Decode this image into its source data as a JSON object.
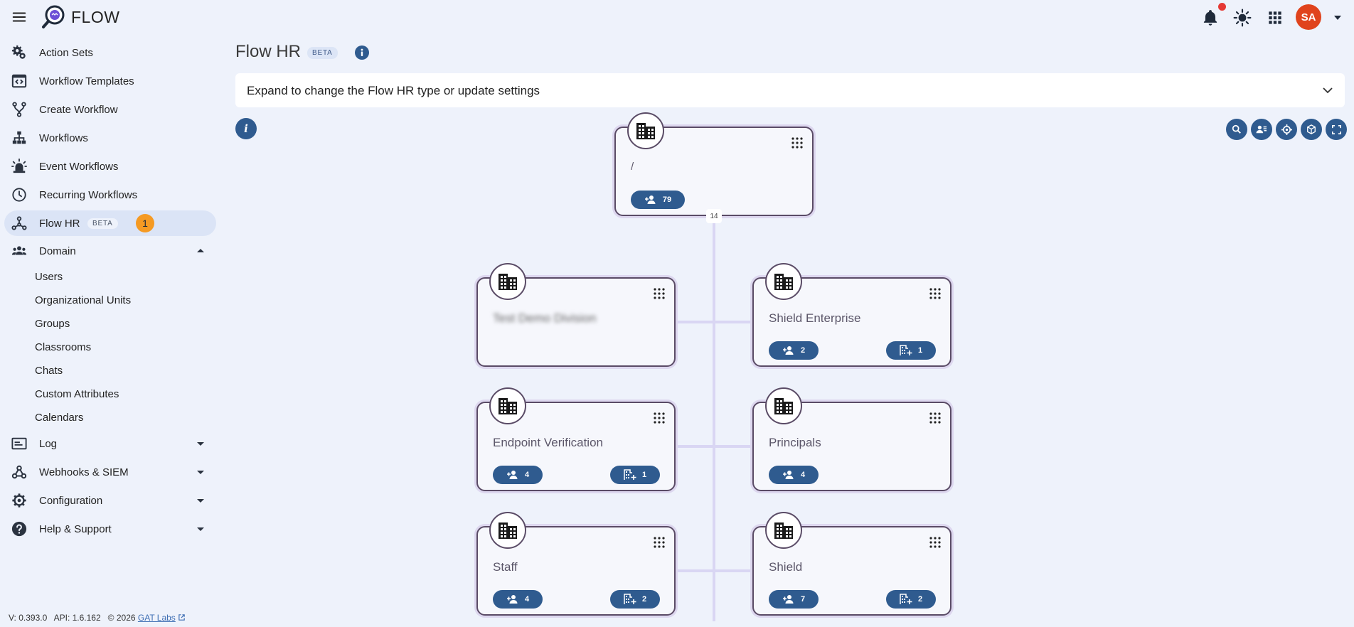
{
  "header": {
    "app_name": "FLOW",
    "avatar_initials": "SA",
    "accent_color": "#2f5b8f",
    "avatar_color": "#e0431c"
  },
  "sidebar": {
    "items": [
      {
        "label": "Action Sets",
        "icon": "gears-icon"
      },
      {
        "label": "Workflow Templates",
        "icon": "template-icon"
      },
      {
        "label": "Create Workflow",
        "icon": "branch-icon"
      },
      {
        "label": "Workflows",
        "icon": "hierarchy-icon"
      },
      {
        "label": "Event Workflows",
        "icon": "alarm-icon"
      },
      {
        "label": "Recurring Workflows",
        "icon": "clock-icon"
      },
      {
        "label": "Flow HR",
        "icon": "org-icon",
        "badge": "BETA",
        "count": "1",
        "active": true
      },
      {
        "label": "Domain",
        "icon": "people-icon",
        "expanded": true
      },
      {
        "label": "Log",
        "icon": "log-icon"
      },
      {
        "label": "Webhooks & SIEM",
        "icon": "webhook-icon"
      },
      {
        "label": "Configuration",
        "icon": "gear-icon"
      },
      {
        "label": "Help & Support",
        "icon": "help-icon"
      }
    ],
    "domain_subitems": [
      "Users",
      "Organizational Units",
      "Groups",
      "Classrooms",
      "Chats",
      "Custom Attributes",
      "Calendars"
    ],
    "footer": {
      "version": "V: 0.393.0",
      "api": "API: 1.6.162",
      "copyright": "© 2026",
      "company": "GAT Labs"
    }
  },
  "main": {
    "title": "Flow HR",
    "title_badge": "BETA",
    "expander_text": "Expand to change the Flow HR type or update settings",
    "info_letter": "i",
    "toolbar": [
      "search-icon",
      "person-list-icon",
      "crosshair-icon",
      "cube-icon",
      "fullscreen-icon"
    ]
  },
  "org_chart": {
    "root": {
      "name": "/",
      "users": "79",
      "children_count": "14"
    },
    "nodes": [
      {
        "name": "Test Demo Division",
        "blurred": true,
        "users": null,
        "ous": null
      },
      {
        "name": "Shield Enterprise",
        "users": "2",
        "ous": "1"
      },
      {
        "name": "Endpoint Verification",
        "users": "4",
        "ous": "1"
      },
      {
        "name": "Principals",
        "users": "4",
        "ous": null
      },
      {
        "name": "Staff",
        "users": "4",
        "ous": "2"
      },
      {
        "name": "Shield",
        "users": "7",
        "ous": "2"
      }
    ]
  }
}
